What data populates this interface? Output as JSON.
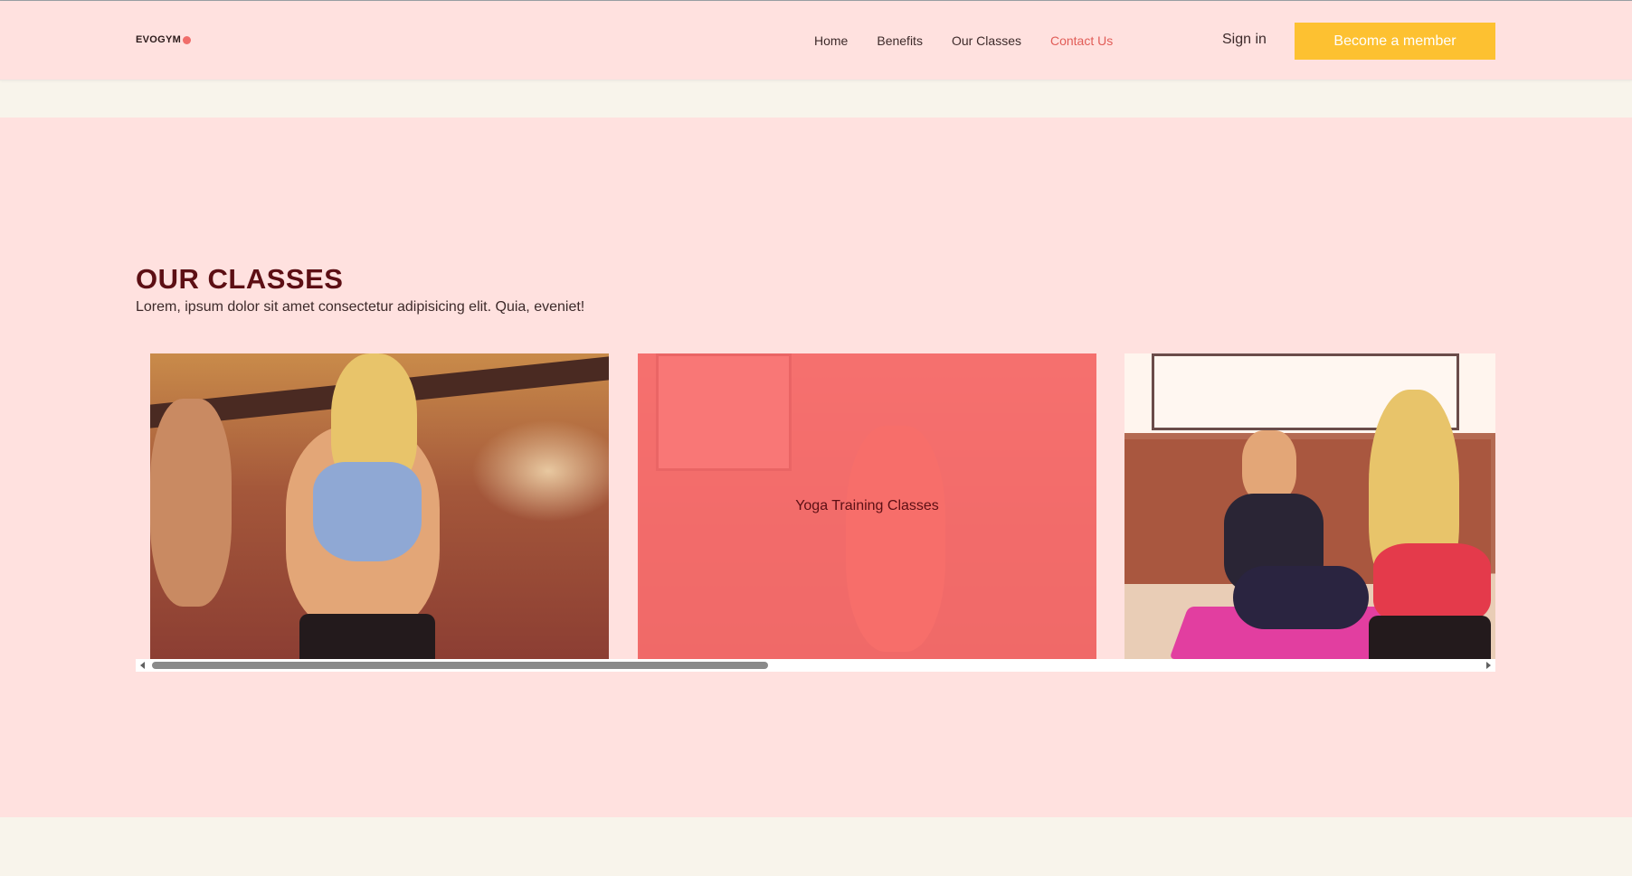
{
  "header": {
    "logo": "EVOGYM",
    "nav": [
      {
        "label": "Home",
        "active": false
      },
      {
        "label": "Benefits",
        "active": false
      },
      {
        "label": "Our Classes",
        "active": false
      },
      {
        "label": "Contact Us",
        "active": true
      }
    ],
    "sign_in": "Sign in",
    "cta": "Become a member"
  },
  "classes": {
    "title": "OUR CLASSES",
    "subtitle": "Lorem, ipsum dolor sit amet consectetur adipisicing elit. Quia, eveniet!",
    "cards": [
      {
        "label": ""
      },
      {
        "label": "Yoga Training Classes"
      },
      {
        "label": ""
      }
    ],
    "scroll_position": 0
  },
  "colors": {
    "page_bg": "#f8f4eb",
    "section_bg": "#ffe1df",
    "accent": "#fdc131",
    "active_link": "#e15c57",
    "title": "#5c0f14",
    "overlay": "#f86868"
  }
}
